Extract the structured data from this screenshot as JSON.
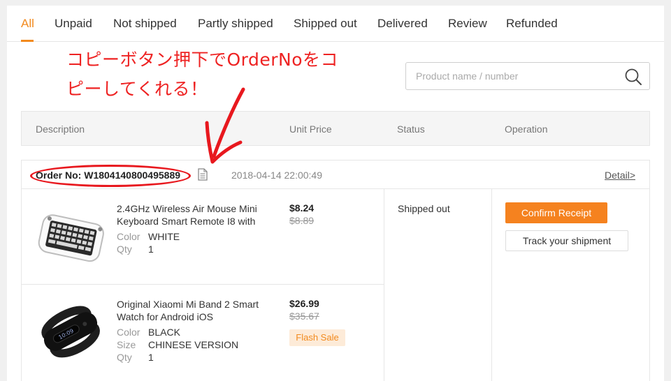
{
  "tabs": [
    {
      "label": "All",
      "active": true
    },
    {
      "label": "Unpaid"
    },
    {
      "label": "Not shipped"
    },
    {
      "label": "Partly shipped"
    },
    {
      "label": "Shipped out"
    },
    {
      "label": "Delivered"
    },
    {
      "label": "Review"
    },
    {
      "label": "Refunded"
    }
  ],
  "annotation": {
    "line1": "コピーボタン押下でOrderNoをコ",
    "line2": "ピーしてくれる！",
    "color": "#ee2222"
  },
  "search": {
    "placeholder": "Product name / number"
  },
  "table_header": {
    "description": "Description",
    "unit_price": "Unit Price",
    "status": "Status",
    "operation": "Operation"
  },
  "order": {
    "order_no": "Order No: W1804140800495889",
    "date": "2018-04-14 22:00:49",
    "detail_link": "Detail>",
    "status": "Shipped out",
    "actions": {
      "confirm": "Confirm Receipt",
      "track": "Track your shipment"
    },
    "items": [
      {
        "title": "2.4GHz Wireless Air Mouse Mini Keyboard Smart Remote I8 with",
        "specs": [
          {
            "key": "Color",
            "value": "WHITE"
          },
          {
            "key": "Qty",
            "value": "1"
          }
        ],
        "price": "$8.24",
        "original_price": "$8.89",
        "thumb": "keyboard-icon"
      },
      {
        "title": "Original Xiaomi Mi Band 2 Smart Watch for Android iOS",
        "specs": [
          {
            "key": "Color",
            "value": "BLACK"
          },
          {
            "key": "Size",
            "value": "CHINESE VERSION"
          },
          {
            "key": "Qty",
            "value": "1"
          }
        ],
        "price": "$26.99",
        "original_price": "$35.67",
        "badge": "Flash Sale",
        "thumb": "smart-band-icon"
      }
    ]
  },
  "colors": {
    "accent": "#f28a1e",
    "button": "#f5821f",
    "annotation": "#ee2222"
  }
}
